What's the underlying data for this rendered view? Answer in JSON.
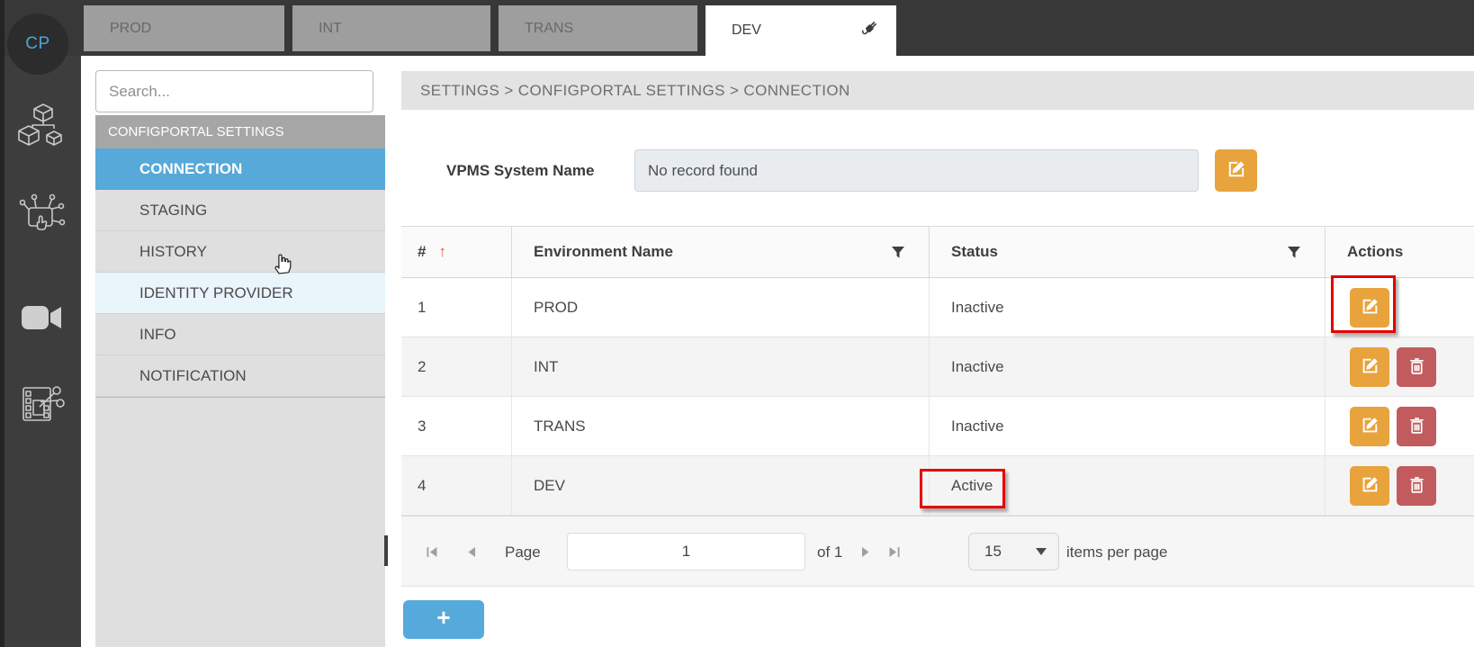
{
  "topbar": {
    "avatar_initials": "CP",
    "tabs": [
      {
        "label": "PROD",
        "active": false
      },
      {
        "label": "INT",
        "active": false
      },
      {
        "label": "TRANS",
        "active": false
      },
      {
        "label": "DEV",
        "active": true,
        "icon": "plug-icon"
      }
    ]
  },
  "sidebar": {
    "icons": [
      {
        "name": "modules-cubes-icon"
      },
      {
        "name": "interactive-panel-icon"
      },
      {
        "name": "video-camera-icon"
      },
      {
        "name": "media-editing-icon"
      }
    ]
  },
  "nav": {
    "search_placeholder": "Search...",
    "section_title": "CONFIGPORTAL SETTINGS",
    "items": [
      {
        "label": "CONNECTION",
        "state": "selected"
      },
      {
        "label": "STAGING",
        "state": "normal"
      },
      {
        "label": "HISTORY",
        "state": "normal"
      },
      {
        "label": "IDENTITY PROVIDER",
        "state": "hover"
      },
      {
        "label": "INFO",
        "state": "normal"
      },
      {
        "label": "NOTIFICATION",
        "state": "normal"
      }
    ]
  },
  "main": {
    "breadcrumb": "SETTINGS > CONFIGPORTAL SETTINGS > CONNECTION",
    "vpms": {
      "label": "VPMS System Name",
      "value": "No record found"
    },
    "table": {
      "columns": [
        "#",
        "Environment Name",
        "Status",
        "Actions"
      ],
      "rows": [
        {
          "num": "1",
          "env": "PROD",
          "status": "Inactive",
          "actions": [
            "edit"
          ],
          "edit_highlighted": true
        },
        {
          "num": "2",
          "env": "INT",
          "status": "Inactive",
          "actions": [
            "edit",
            "delete"
          ],
          "edit_highlighted": false
        },
        {
          "num": "3",
          "env": "TRANS",
          "status": "Inactive",
          "actions": [
            "edit",
            "delete"
          ],
          "edit_highlighted": false
        },
        {
          "num": "4",
          "env": "DEV",
          "status": "Active",
          "actions": [
            "edit",
            "delete"
          ],
          "status_highlighted": true
        }
      ]
    },
    "pager": {
      "page_label": "Page",
      "page_value": "1",
      "of_label": "of 1",
      "page_size": "15",
      "items_per_page_label": "items per page"
    },
    "add_button_label": "+"
  },
  "colors": {
    "selected_blue": "#56a9d9",
    "edit_orange": "#e8a33c",
    "delete_red": "#c15b5e",
    "annotation_red": "#e60000",
    "add_button_blue": "#55aadb"
  }
}
